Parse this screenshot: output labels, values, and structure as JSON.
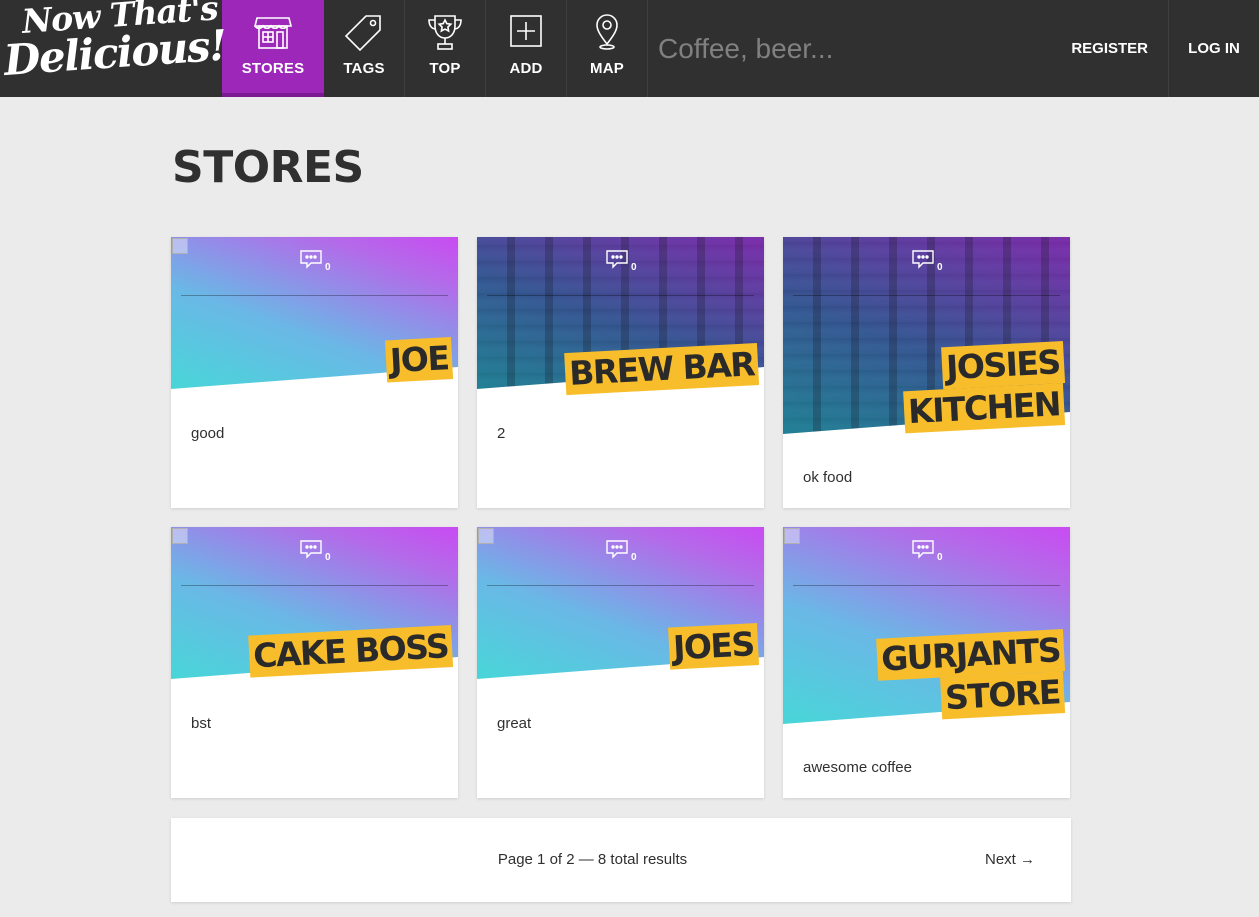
{
  "brand": {
    "line1": "Now That's",
    "line2": "Delicious!"
  },
  "nav": {
    "items": [
      {
        "label": "STORES",
        "icon": "store-icon",
        "active": true
      },
      {
        "label": "TAGS",
        "icon": "tag-icon"
      },
      {
        "label": "TOP",
        "icon": "trophy-icon"
      },
      {
        "label": "ADD",
        "icon": "add-icon"
      },
      {
        "label": "MAP",
        "icon": "map-pin-icon"
      }
    ],
    "search_placeholder": "Coffee, beer...",
    "register": "REGISTER",
    "login": "LOG IN"
  },
  "page": {
    "title": "STORES"
  },
  "stores": [
    {
      "name_lines": [
        "JOE"
      ],
      "description": "good",
      "comments": "0",
      "photo": false
    },
    {
      "name_lines": [
        "BREW BAR"
      ],
      "description": "2",
      "comments": "0",
      "photo": true
    },
    {
      "name_lines": [
        "JOSIES",
        "KITCHEN"
      ],
      "description": "ok food",
      "comments": "0",
      "photo": true
    },
    {
      "name_lines": [
        "CAKE BOSS"
      ],
      "description": "bst",
      "comments": "0",
      "photo": false
    },
    {
      "name_lines": [
        "JOES"
      ],
      "description": "great",
      "comments": "0",
      "photo": false
    },
    {
      "name_lines": [
        "GURJANTS",
        "STORE"
      ],
      "description": "awesome coffee",
      "comments": "0",
      "photo": false
    }
  ],
  "pagination": {
    "info": "Page 1 of 2 — 8 total results",
    "next": "Next →"
  },
  "colors": {
    "nav_bg": "#303030",
    "accent": "#9c27b8",
    "title_highlight": "#f7bd2b",
    "page_bg": "#ebebeb"
  }
}
